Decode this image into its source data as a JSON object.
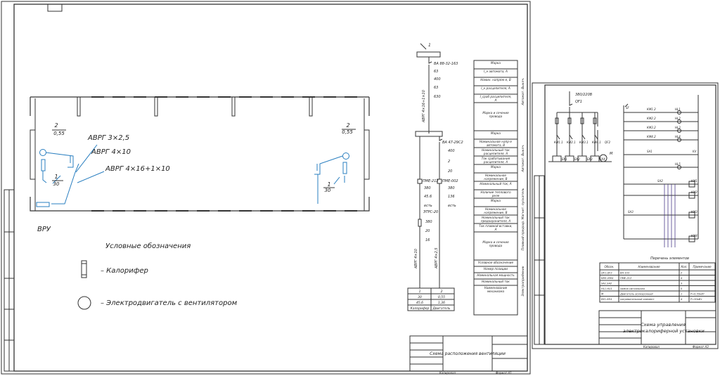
{
  "sheet1": {
    "plan": {
      "cable1": "АВРГ 3×2,5",
      "cable2": "АВРГ 4×10",
      "cable3": "АВРГ 4×16+1×10",
      "left_num": "2",
      "left_val": "0,55",
      "right_num": "2",
      "right_val": "0,55",
      "left_heater_num": "1",
      "left_heater_val": "30",
      "right_heater_num": "1",
      "right_heater_val": "30",
      "vru": "ВРУ"
    },
    "legend": {
      "title": "Условные обозначения",
      "heater": "– Калорифер",
      "motor": "– Электродвигатель с вентилятором"
    },
    "single_line": {
      "top_number": "1",
      "breaker_main": "ВА 88-32-163",
      "main_values": [
        "63",
        "400",
        "63",
        "630"
      ],
      "cable_main": "АВРГ 4×16+1×10",
      "breaker2": "ВА 47-29С2",
      "b2_values": [
        "400",
        "2",
        "20",
        "20"
      ],
      "starter1": "ПМЕ-212",
      "starter2": "ПМЕ-002",
      "s1_values": [
        "380",
        "45.6",
        "есть"
      ],
      "s2_values": [
        "380",
        "136",
        "есть"
      ],
      "relay": "ЭТРС-20",
      "relay_values": [
        "380",
        "20",
        "16"
      ],
      "cable_left": "АВРГ 4×10",
      "cable_right": "АВРГ 4×2,5",
      "bottom_table": [
        [
          "1",
          "2"
        ],
        [
          "30",
          "0,55"
        ],
        [
          "45,6",
          "1,36"
        ],
        [
          "Калорифер",
          "Двигатель"
        ]
      ]
    },
    "params_col": [
      "Марка",
      "I_н автомата, А",
      "Номин. напряж-е, В",
      "I_н расцепителя, А",
      "I_сраб расцепителя, А",
      "Марка и сечение провода",
      "Марка",
      "Номинальное напр-е автомата, В",
      "Номинальный ток расцепителя, А",
      "Ток срабатывания расцепителя, А",
      "Марка",
      "Номинальное напряжение, В",
      "Номинальный ток, А",
      "Наличие теплового реле",
      "Марка",
      "Номинальное напряжение, В",
      "Номинальный ток предохранителя, А",
      "Ток плавкой вставки, А",
      "Марка и сечение провода",
      "Условное обозначение",
      "Номер позиции",
      "Номинальная мощность",
      "Номинальный ток",
      "Наименование механизма"
    ],
    "side_labels": [
      "Автомат. Выклч.",
      "Автомат. Выклч.",
      "Магнит. пускатель",
      "Плавкий предохр.",
      "Электроприёмник"
    ],
    "title_block": "Схема расположения вентиляции",
    "footer_left": "Копировал",
    "footer_right": "Формат А1"
  },
  "sheet2": {
    "supply": "380/220В",
    "qf1": "QF1",
    "contactors": [
      "КМ1.1",
      "КМ2.1",
      "КМ3.1",
      "КМ4.1"
    ],
    "qf2": "QF2",
    "heaters": [
      "EK1",
      "EK2",
      "EK3",
      "EK4"
    ],
    "motor": "М",
    "control_labels": [
      "SF",
      "HL1",
      "КМ1.2",
      "HL2",
      "КМ2.2",
      "HL3",
      "КМ3.2",
      "HL4",
      "КМ4.2",
      "SA1",
      "KV",
      "HL5",
      "SA2",
      "КМ1",
      "SA3",
      "КМ2",
      "КМ3",
      "КМ4"
    ],
    "spec_title": "Перечень элементов",
    "spec_headers": [
      "Обозн.",
      "Наименование",
      "Кол.",
      "Примечание"
    ],
    "spec_rows": [
      [
        "QF1,QF2",
        "ВА-103",
        "2",
        ""
      ],
      [
        "КМ1-КМ4",
        "ПМЕ-212",
        "4",
        ""
      ],
      [
        "SA1,SA2",
        "",
        "3",
        ""
      ],
      [
        "HL1-HL5",
        "лампа сигнальная",
        "5",
        ""
      ],
      [
        "М",
        "Двигатель асинхронный",
        "1",
        "Р=0,55кВт"
      ],
      [
        "EK1-EK4",
        "нагревательный элемент",
        "4",
        "Р=30кВт"
      ]
    ],
    "title_block": "Схема управления электрокалориферной установки",
    "footer_left": "Копировал",
    "footer_right": "Формат А3"
  }
}
